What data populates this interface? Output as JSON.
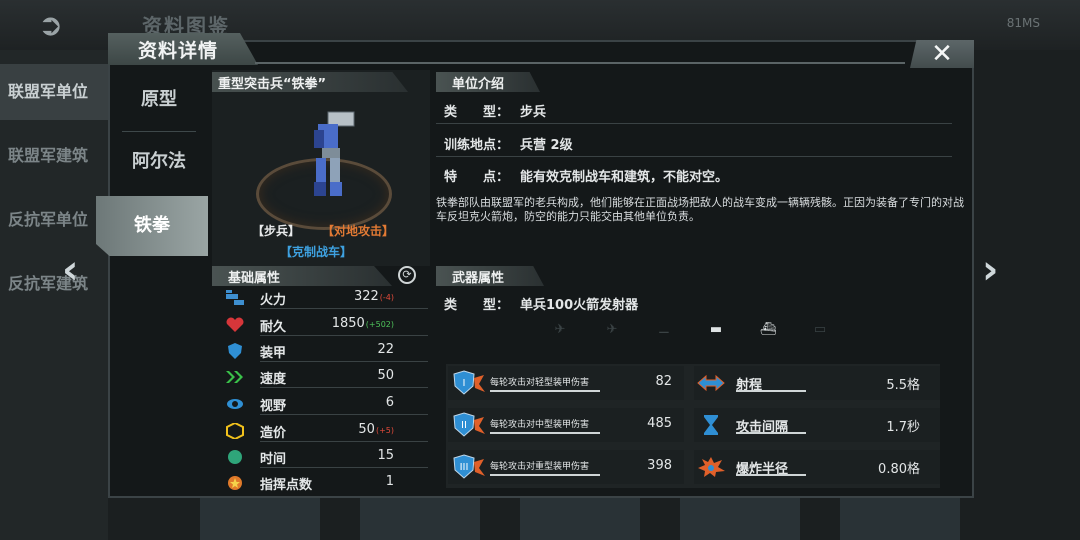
{
  "background": {
    "page_title": "资料图鉴",
    "status": "81MS",
    "side_items": [
      "联盟军单位",
      "联盟军建筑",
      "反抗军单位",
      "反抗军建筑"
    ]
  },
  "panel": {
    "title": "资料详情",
    "close_label": "✕",
    "tabs": [
      "原型",
      "阿尔法",
      "铁拳"
    ],
    "active_tab": "铁拳"
  },
  "unit": {
    "name": "重型突击兵“铁拳”",
    "tag_type": "【步兵】",
    "tag_attack": "【对地攻击】",
    "tag_counter": "【克制战车】"
  },
  "base_attributes": {
    "title": "基础属性",
    "rows": [
      {
        "label": "火力",
        "value": "322",
        "bonus": "(-4)",
        "bonus_color": "#e04a3a",
        "icon": "firepower-icon"
      },
      {
        "label": "耐久",
        "value": "1850",
        "bonus": "(+502)",
        "bonus_color": "#4ec25a",
        "icon": "heart-icon"
      },
      {
        "label": "装甲",
        "value": "22",
        "bonus": "",
        "icon": "shield-icon"
      },
      {
        "label": "速度",
        "value": "50",
        "bonus": "",
        "icon": "speed-icon"
      },
      {
        "label": "视野",
        "value": "6",
        "bonus": "",
        "icon": "eye-icon"
      },
      {
        "label": "造价",
        "value": "50",
        "bonus": "(+5)",
        "bonus_color": "#e04a3a",
        "icon": "cost-icon"
      },
      {
        "label": "时间",
        "value": "15",
        "bonus": "",
        "icon": "time-icon"
      },
      {
        "label": "指挥点数",
        "value": "1",
        "bonus": "",
        "icon": "command-points-icon"
      }
    ]
  },
  "intro": {
    "title": "单位介绍",
    "type_key": "类　　型：",
    "type_value": "步兵",
    "training_key": "训练地点：",
    "training_value": "兵营 2级",
    "feature_key": "特　　点：",
    "feature_value": "能有效克制战车和建筑，不能对空。",
    "description": "铁拳部队由联盟军的老兵构成，他们能够在正面战场把敌人的战车变成一辆辆残骸。正因为装备了专门的对战车反坦克火箭炮，防空的能力只能交由其他单位负责。"
  },
  "weapon": {
    "title": "武器属性",
    "type_key": "类　　型：",
    "type_value": "单兵100火箭发射器",
    "targets": [
      {
        "icon": "fighter-jet-icon",
        "active": false
      },
      {
        "icon": "bomber-icon",
        "active": false
      },
      {
        "icon": "helicopter-icon",
        "active": false
      },
      {
        "icon": "tank-icon",
        "active": true
      },
      {
        "icon": "ship-icon",
        "active": true
      },
      {
        "icon": "submarine-icon",
        "active": false
      }
    ],
    "damage": [
      {
        "label": "每轮攻击对轻型装甲伤害",
        "value": "82",
        "icon": "armor-light-icon"
      },
      {
        "label": "每轮攻击对中型装甲伤害",
        "value": "485",
        "icon": "armor-medium-icon"
      },
      {
        "label": "每轮攻击对重型装甲伤害",
        "value": "398",
        "icon": "armor-heavy-icon"
      }
    ],
    "stats": [
      {
        "label": "射程",
        "value": "5.5格",
        "icon": "range-icon"
      },
      {
        "label": "攻击间隔",
        "value": "1.7秒",
        "icon": "hourglass-icon"
      },
      {
        "label": "爆炸半径",
        "value": "0.80格",
        "icon": "explosion-icon"
      }
    ]
  },
  "colors": {
    "accent_orange": "#e27a34",
    "accent_blue": "#3ea1e0",
    "panel_bg": "#141819"
  }
}
